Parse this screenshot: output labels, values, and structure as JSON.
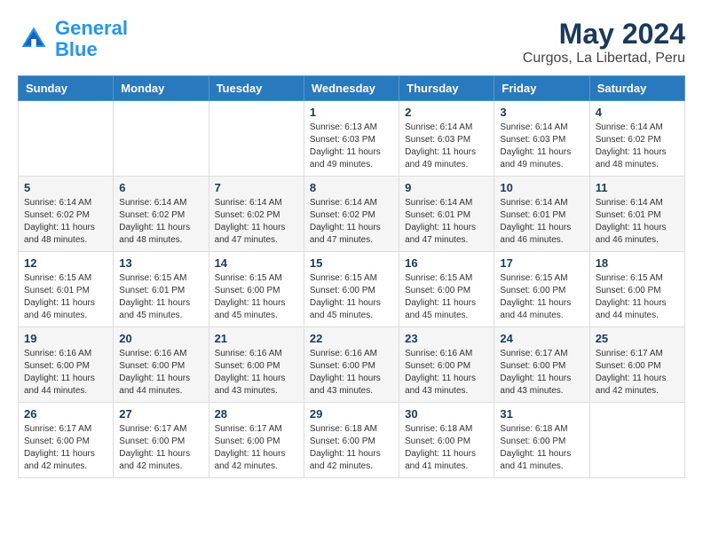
{
  "header": {
    "logo_line1": "General",
    "logo_line2": "Blue",
    "title": "May 2024",
    "subtitle": "Curgos, La Libertad, Peru"
  },
  "weekdays": [
    "Sunday",
    "Monday",
    "Tuesday",
    "Wednesday",
    "Thursday",
    "Friday",
    "Saturday"
  ],
  "weeks": [
    [
      {
        "day": "",
        "info": ""
      },
      {
        "day": "",
        "info": ""
      },
      {
        "day": "",
        "info": ""
      },
      {
        "day": "1",
        "info": "Sunrise: 6:13 AM\nSunset: 6:03 PM\nDaylight: 11 hours\nand 49 minutes."
      },
      {
        "day": "2",
        "info": "Sunrise: 6:14 AM\nSunset: 6:03 PM\nDaylight: 11 hours\nand 49 minutes."
      },
      {
        "day": "3",
        "info": "Sunrise: 6:14 AM\nSunset: 6:03 PM\nDaylight: 11 hours\nand 49 minutes."
      },
      {
        "day": "4",
        "info": "Sunrise: 6:14 AM\nSunset: 6:02 PM\nDaylight: 11 hours\nand 48 minutes."
      }
    ],
    [
      {
        "day": "5",
        "info": "Sunrise: 6:14 AM\nSunset: 6:02 PM\nDaylight: 11 hours\nand 48 minutes."
      },
      {
        "day": "6",
        "info": "Sunrise: 6:14 AM\nSunset: 6:02 PM\nDaylight: 11 hours\nand 48 minutes."
      },
      {
        "day": "7",
        "info": "Sunrise: 6:14 AM\nSunset: 6:02 PM\nDaylight: 11 hours\nand 47 minutes."
      },
      {
        "day": "8",
        "info": "Sunrise: 6:14 AM\nSunset: 6:02 PM\nDaylight: 11 hours\nand 47 minutes."
      },
      {
        "day": "9",
        "info": "Sunrise: 6:14 AM\nSunset: 6:01 PM\nDaylight: 11 hours\nand 47 minutes."
      },
      {
        "day": "10",
        "info": "Sunrise: 6:14 AM\nSunset: 6:01 PM\nDaylight: 11 hours\nand 46 minutes."
      },
      {
        "day": "11",
        "info": "Sunrise: 6:14 AM\nSunset: 6:01 PM\nDaylight: 11 hours\nand 46 minutes."
      }
    ],
    [
      {
        "day": "12",
        "info": "Sunrise: 6:15 AM\nSunset: 6:01 PM\nDaylight: 11 hours\nand 46 minutes."
      },
      {
        "day": "13",
        "info": "Sunrise: 6:15 AM\nSunset: 6:01 PM\nDaylight: 11 hours\nand 45 minutes."
      },
      {
        "day": "14",
        "info": "Sunrise: 6:15 AM\nSunset: 6:00 PM\nDaylight: 11 hours\nand 45 minutes."
      },
      {
        "day": "15",
        "info": "Sunrise: 6:15 AM\nSunset: 6:00 PM\nDaylight: 11 hours\nand 45 minutes."
      },
      {
        "day": "16",
        "info": "Sunrise: 6:15 AM\nSunset: 6:00 PM\nDaylight: 11 hours\nand 45 minutes."
      },
      {
        "day": "17",
        "info": "Sunrise: 6:15 AM\nSunset: 6:00 PM\nDaylight: 11 hours\nand 44 minutes."
      },
      {
        "day": "18",
        "info": "Sunrise: 6:15 AM\nSunset: 6:00 PM\nDaylight: 11 hours\nand 44 minutes."
      }
    ],
    [
      {
        "day": "19",
        "info": "Sunrise: 6:16 AM\nSunset: 6:00 PM\nDaylight: 11 hours\nand 44 minutes."
      },
      {
        "day": "20",
        "info": "Sunrise: 6:16 AM\nSunset: 6:00 PM\nDaylight: 11 hours\nand 44 minutes."
      },
      {
        "day": "21",
        "info": "Sunrise: 6:16 AM\nSunset: 6:00 PM\nDaylight: 11 hours\nand 43 minutes."
      },
      {
        "day": "22",
        "info": "Sunrise: 6:16 AM\nSunset: 6:00 PM\nDaylight: 11 hours\nand 43 minutes."
      },
      {
        "day": "23",
        "info": "Sunrise: 6:16 AM\nSunset: 6:00 PM\nDaylight: 11 hours\nand 43 minutes."
      },
      {
        "day": "24",
        "info": "Sunrise: 6:17 AM\nSunset: 6:00 PM\nDaylight: 11 hours\nand 43 minutes."
      },
      {
        "day": "25",
        "info": "Sunrise: 6:17 AM\nSunset: 6:00 PM\nDaylight: 11 hours\nand 42 minutes."
      }
    ],
    [
      {
        "day": "26",
        "info": "Sunrise: 6:17 AM\nSunset: 6:00 PM\nDaylight: 11 hours\nand 42 minutes."
      },
      {
        "day": "27",
        "info": "Sunrise: 6:17 AM\nSunset: 6:00 PM\nDaylight: 11 hours\nand 42 minutes."
      },
      {
        "day": "28",
        "info": "Sunrise: 6:17 AM\nSunset: 6:00 PM\nDaylight: 11 hours\nand 42 minutes."
      },
      {
        "day": "29",
        "info": "Sunrise: 6:18 AM\nSunset: 6:00 PM\nDaylight: 11 hours\nand 42 minutes."
      },
      {
        "day": "30",
        "info": "Sunrise: 6:18 AM\nSunset: 6:00 PM\nDaylight: 11 hours\nand 41 minutes."
      },
      {
        "day": "31",
        "info": "Sunrise: 6:18 AM\nSunset: 6:00 PM\nDaylight: 11 hours\nand 41 minutes."
      },
      {
        "day": "",
        "info": ""
      }
    ]
  ]
}
